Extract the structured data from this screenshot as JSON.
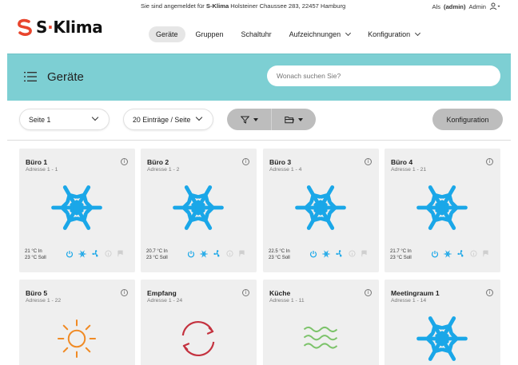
{
  "brand": {
    "logo_text_s": "S",
    "logo_text_rest": "Klima",
    "color": "#e8452d"
  },
  "header": {
    "login_prefix": "Sie sind angemeldet für ",
    "login_company": "S-Klima",
    "login_suffix": " Holsteiner Chaussee 283, 22457 Hamburg",
    "user_prefix": "Als ",
    "user_role": "(admin)",
    "user_name": "Admin"
  },
  "nav": [
    {
      "label": "Geräte",
      "active": true
    },
    {
      "label": "Gruppen"
    },
    {
      "label": "Schaltuhr"
    },
    {
      "label": "Aufzeichnungen",
      "dropdown": true
    },
    {
      "label": "Konfiguration",
      "dropdown": true
    }
  ],
  "band": {
    "title": "Geräte",
    "search_placeholder": "Wonach suchen Sie?",
    "color": "#7dcfd3"
  },
  "toolbar": {
    "page_select": "Seite 1",
    "per_page_select": "20 Einträge / Seite",
    "filter_icon": "filter-icon",
    "folder_icon": "folder-icon",
    "config_label": "Konfiguration"
  },
  "devices": [
    {
      "name": "Büro 1",
      "address": "Adresse 1 - 1",
      "mode": "cool",
      "temp_in": "21 °C In",
      "temp_set": "23 °C Soll"
    },
    {
      "name": "Büro 2",
      "address": "Adresse 1 - 2",
      "mode": "cool",
      "temp_in": "20.7 °C In",
      "temp_set": "23 °C Soll"
    },
    {
      "name": "Büro 3",
      "address": "Adresse 1 - 4",
      "mode": "cool",
      "temp_in": "22.5 °C In",
      "temp_set": "23 °C Soll"
    },
    {
      "name": "Büro 4",
      "address": "Adresse 1 - 21",
      "mode": "cool",
      "temp_in": "21.7 °C In",
      "temp_set": "23 °C Soll"
    },
    {
      "name": "Büro 5",
      "address": "Adresse 1 - 22",
      "mode": "heat"
    },
    {
      "name": "Empfang",
      "address": "Adresse 1 - 24",
      "mode": "auto"
    },
    {
      "name": "Küche",
      "address": "Adresse 1 - 11",
      "mode": "fan"
    },
    {
      "name": "Meetingraum 1",
      "address": "Adresse 1 - 14",
      "mode": "cool"
    }
  ],
  "colors": {
    "cool": "#1aa7e8",
    "heat": "#f08a24",
    "auto": "#c4323f",
    "fan": "#7cc36a",
    "muted": "#cfcfcf"
  }
}
